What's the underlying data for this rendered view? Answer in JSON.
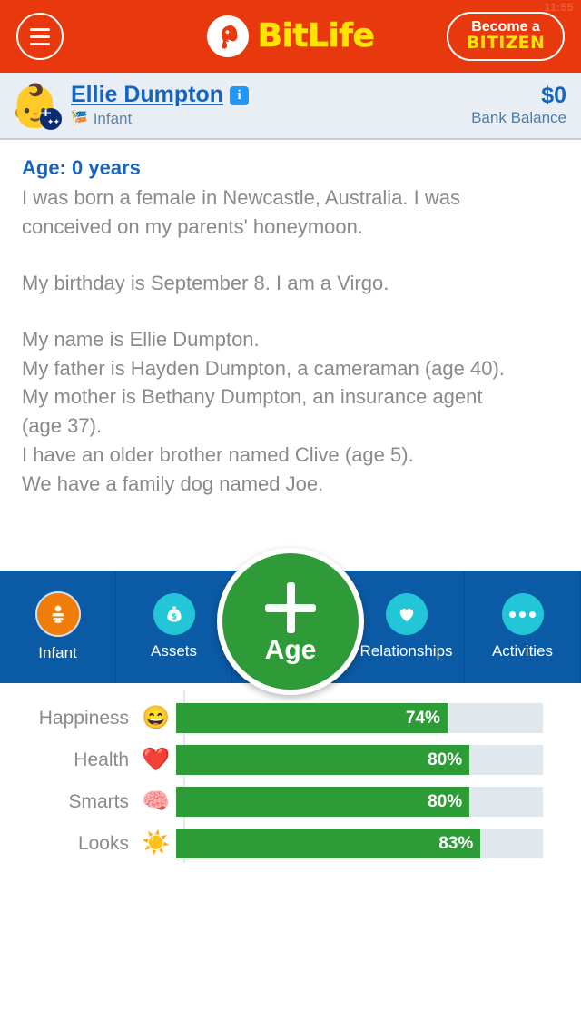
{
  "status": {
    "clock": "11:55"
  },
  "topbar": {
    "menu_icon": "hamburger-menu-icon",
    "logo_text": "BitLife",
    "logo_mark": "embryo-icon",
    "bitizen_top": "Become a",
    "bitizen_bottom": "BITIZEN"
  },
  "profile": {
    "avatar_emoji": "👶",
    "flag": "australia-flag",
    "name": "Ellie Dumpton",
    "info_icon": "i",
    "stage_icon": "🎏",
    "stage": "Infant",
    "bank_amount": "$0",
    "bank_label": "Bank Balance"
  },
  "story": {
    "age_heading": "Age: 0 years",
    "paragraph1": [
      "I was born a female in Newcastle, Australia. I was",
      "conceived on my parents' honeymoon."
    ],
    "paragraph2": [
      "My birthday is September 8. I am a Virgo."
    ],
    "paragraph3": [
      "My name is Ellie Dumpton.",
      "My father is Hayden Dumpton, a cameraman (age 40).",
      "My mother is Bethany Dumpton, an insurance agent",
      "(age 37).",
      "I have an older brother named Clive (age 5).",
      "We have a family dog named Joe."
    ]
  },
  "nav": {
    "items": [
      {
        "label": "Infant",
        "icon": "baby-icon",
        "color": "#f07d09",
        "active": true
      },
      {
        "label": "Assets",
        "icon": "money-bag-icon",
        "color": "#23c6d6",
        "active": false
      },
      {
        "label": "Relationships",
        "icon": "heart-icon",
        "color": "#23c6d6",
        "active": false
      },
      {
        "label": "Activities",
        "icon": "ellipsis-icon",
        "color": "#23c6d6",
        "active": false
      }
    ],
    "age_button": {
      "label": "Age",
      "icon": "plus-icon",
      "color": "#2e9b38"
    }
  },
  "stats": {
    "rows": [
      {
        "name": "Happiness",
        "emoji": "😄",
        "value": 74,
        "display": "74%"
      },
      {
        "name": "Health",
        "emoji": "❤️",
        "value": 80,
        "display": "80%"
      },
      {
        "name": "Smarts",
        "emoji": "🧠",
        "value": 80,
        "display": "80%"
      },
      {
        "name": "Looks",
        "emoji": "☀️",
        "value": 83,
        "display": "83%"
      }
    ],
    "fill_color": "#2d9c37",
    "track_color": "#e0e8ee"
  }
}
